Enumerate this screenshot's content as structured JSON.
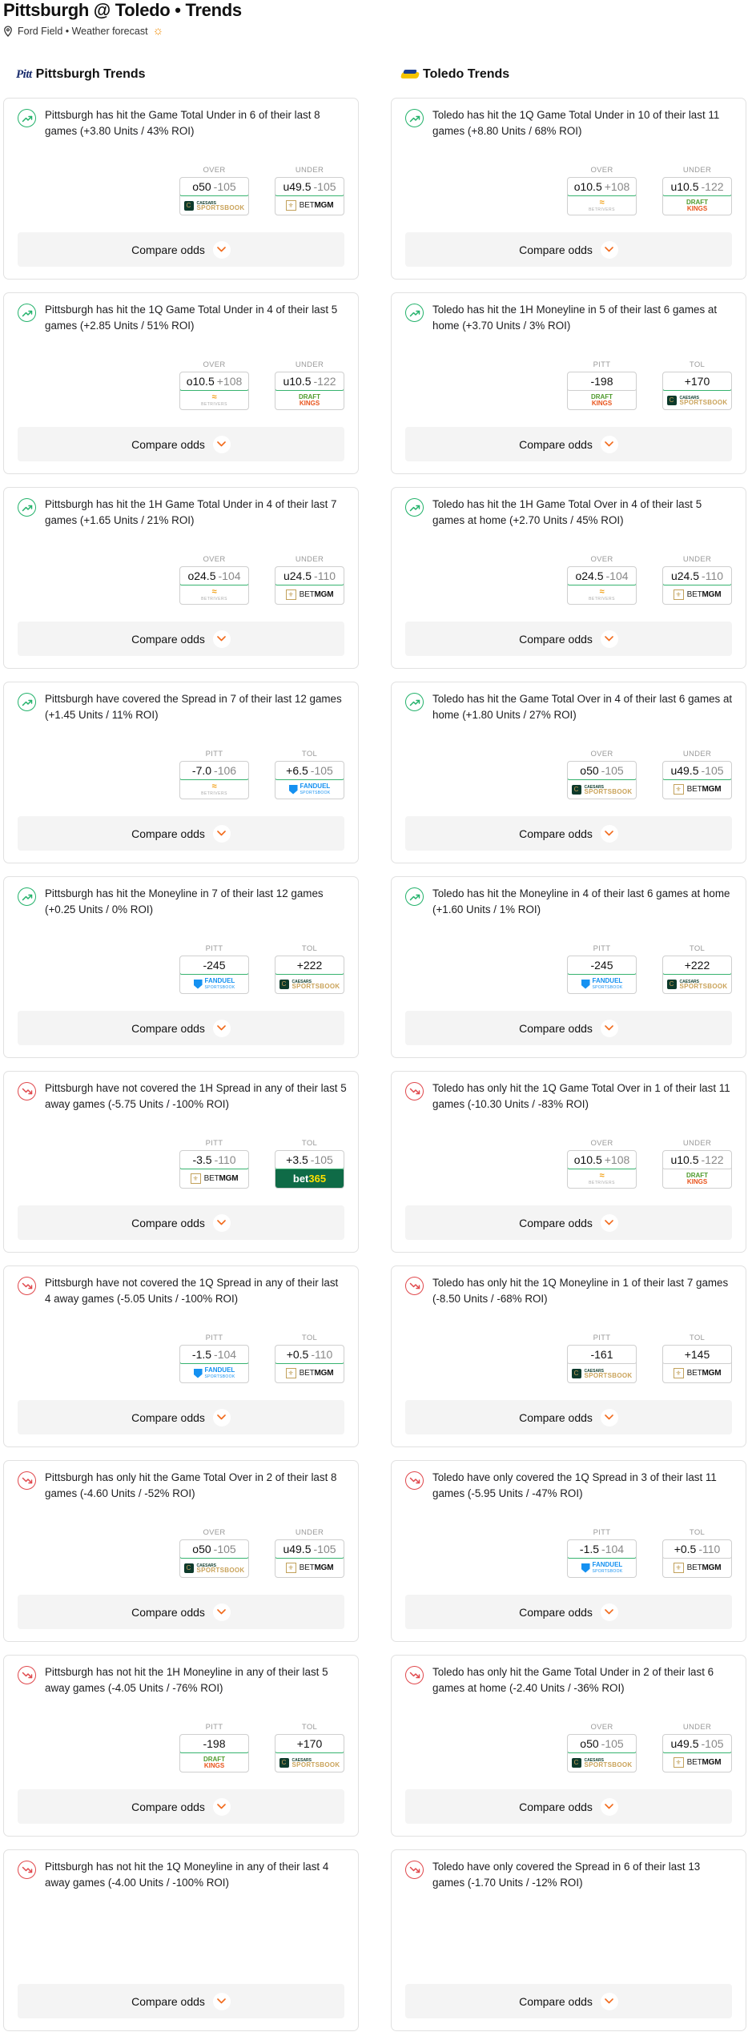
{
  "header": {
    "title": "Pittsburgh @ Toledo • Trends",
    "subtitle": "Ford Field • Weather forecast"
  },
  "columns": [
    {
      "id": "left",
      "heading": "Pittsburgh Trends",
      "logo_text": "Pitt",
      "cards": [
        {
          "trend": "up",
          "text": "Pittsburgh has hit the Game Total Under in 6 of their last 8 games (+3.80 Units / 43% ROI)",
          "bets": [
            {
              "label": "OVER",
              "line": "o50",
              "odds": "-105",
              "book": "caesars",
              "highlight": true
            },
            {
              "label": "UNDER",
              "line": "u49.5",
              "odds": "-105",
              "book": "betmgm",
              "highlight": true
            }
          ]
        },
        {
          "trend": "up",
          "text": "Pittsburgh has hit the 1Q Game Total Under in 4 of their last 5 games (+2.85 Units / 51% ROI)",
          "bets": [
            {
              "label": "OVER",
              "line": "o10.5",
              "odds": "+108",
              "book": "betrivers",
              "highlight": true
            },
            {
              "label": "UNDER",
              "line": "u10.5",
              "odds": "-122",
              "book": "draftkings",
              "highlight": true
            }
          ]
        },
        {
          "trend": "up",
          "text": "Pittsburgh has hit the 1H Game Total Under in 4 of their last 7 games (+1.65 Units / 21% ROI)",
          "bets": [
            {
              "label": "OVER",
              "line": "o24.5",
              "odds": "-104",
              "book": "betrivers",
              "highlight": true
            },
            {
              "label": "UNDER",
              "line": "u24.5",
              "odds": "-110",
              "book": "betmgm",
              "highlight": true
            }
          ]
        },
        {
          "trend": "up",
          "text": "Pittsburgh have covered the Spread in 7 of their last 12 games (+1.45 Units / 11% ROI)",
          "bets": [
            {
              "label": "PITT",
              "line": "-7.0",
              "odds": "-106",
              "book": "betrivers",
              "highlight": true
            },
            {
              "label": "TOL",
              "line": "+6.5",
              "odds": "-105",
              "book": "fanduel",
              "highlight": true
            }
          ]
        },
        {
          "trend": "up",
          "text": "Pittsburgh has hit the Moneyline in 7 of their last 12 games (+0.25 Units / 0% ROI)",
          "bets": [
            {
              "label": "PITT",
              "line": "",
              "odds": "-245",
              "book": "fanduel",
              "highlight": true
            },
            {
              "label": "TOL",
              "line": "",
              "odds": "+222",
              "book": "caesars",
              "highlight": true
            }
          ]
        },
        {
          "trend": "down",
          "text": "Pittsburgh have not covered the 1H Spread in any of their last 5 away games (-5.75 Units / -100% ROI)",
          "bets": [
            {
              "label": "PITT",
              "line": "-3.5",
              "odds": "-110",
              "book": "betmgm",
              "highlight": true
            },
            {
              "label": "TOL",
              "line": "+3.5",
              "odds": "-105",
              "book": "bet365",
              "highlight": true
            }
          ]
        },
        {
          "trend": "down",
          "text": "Pittsburgh have not covered the 1Q Spread in any of their last 4 away games (-5.05 Units / -100% ROI)",
          "bets": [
            {
              "label": "PITT",
              "line": "-1.5",
              "odds": "-104",
              "book": "fanduel",
              "highlight": true
            },
            {
              "label": "TOL",
              "line": "+0.5",
              "odds": "-110",
              "book": "betmgm",
              "highlight": true
            }
          ]
        },
        {
          "trend": "down",
          "text": "Pittsburgh has only hit the Game Total Over in 2 of their last 8 games (-4.60 Units / -52% ROI)",
          "bets": [
            {
              "label": "OVER",
              "line": "o50",
              "odds": "-105",
              "book": "caesars",
              "highlight": true
            },
            {
              "label": "UNDER",
              "line": "u49.5",
              "odds": "-105",
              "book": "betmgm",
              "highlight": true
            }
          ]
        },
        {
          "trend": "down",
          "text": "Pittsburgh has not hit the 1H Moneyline in any of their last 5 away games (-4.05 Units / -76% ROI)",
          "bets": [
            {
              "label": "PITT",
              "line": "",
              "odds": "-198",
              "book": "draftkings",
              "highlight": true
            },
            {
              "label": "TOL",
              "line": "",
              "odds": "+170",
              "book": "caesars",
              "highlight": true
            }
          ]
        },
        {
          "trend": "down",
          "text": "Pittsburgh has not hit the 1Q Moneyline in any of their last 4 away games (-4.00 Units / -100% ROI)",
          "bets": []
        }
      ]
    },
    {
      "id": "right",
      "heading": "Toledo Trends",
      "logo_text": "",
      "cards": [
        {
          "trend": "up",
          "text": "Toledo has hit the 1Q Game Total Under in 10 of their last 11 games (+8.80 Units / 68% ROI)",
          "bets": [
            {
              "label": "OVER",
              "line": "o10.5",
              "odds": "+108",
              "book": "betrivers",
              "highlight": true
            },
            {
              "label": "UNDER",
              "line": "u10.5",
              "odds": "-122",
              "book": "draftkings",
              "highlight": true
            }
          ]
        },
        {
          "trend": "up",
          "text": "Toledo has hit the 1H Moneyline in 5 of their last 6 games at home (+3.70 Units / 3% ROI)",
          "bets": [
            {
              "label": "PITT",
              "line": "",
              "odds": "-198",
              "book": "draftkings",
              "highlight": false
            },
            {
              "label": "TOL",
              "line": "",
              "odds": "+170",
              "book": "caesars",
              "highlight": true
            }
          ]
        },
        {
          "trend": "up",
          "text": "Toledo has hit the 1H Game Total Over in 4 of their last 5 games at home (+2.70 Units / 45% ROI)",
          "bets": [
            {
              "label": "OVER",
              "line": "o24.5",
              "odds": "-104",
              "book": "betrivers",
              "highlight": true
            },
            {
              "label": "UNDER",
              "line": "u24.5",
              "odds": "-110",
              "book": "betmgm",
              "highlight": true
            }
          ]
        },
        {
          "trend": "up",
          "text": "Toledo has hit the Game Total Over in 4 of their last 6 games at home (+1.80 Units / 27% ROI)",
          "bets": [
            {
              "label": "OVER",
              "line": "o50",
              "odds": "-105",
              "book": "caesars",
              "highlight": true
            },
            {
              "label": "UNDER",
              "line": "u49.5",
              "odds": "-105",
              "book": "betmgm",
              "highlight": true
            }
          ]
        },
        {
          "trend": "up",
          "text": "Toledo has hit the Moneyline in 4 of their last 6 games at home (+1.60 Units / 1% ROI)",
          "bets": [
            {
              "label": "PITT",
              "line": "",
              "odds": "-245",
              "book": "fanduel",
              "highlight": true
            },
            {
              "label": "TOL",
              "line": "",
              "odds": "+222",
              "book": "caesars",
              "highlight": true
            }
          ]
        },
        {
          "trend": "down",
          "text": "Toledo has only hit the 1Q Game Total Over in 1 of their last 11 games (-10.30 Units / -83% ROI)",
          "bets": [
            {
              "label": "OVER",
              "line": "o10.5",
              "odds": "+108",
              "book": "betrivers",
              "highlight": true
            },
            {
              "label": "UNDER",
              "line": "u10.5",
              "odds": "-122",
              "book": "draftkings",
              "highlight": false
            }
          ]
        },
        {
          "trend": "down",
          "text": "Toledo has only hit the 1Q Moneyline in 1 of their last 7 games (-8.50 Units / -68% ROI)",
          "bets": [
            {
              "label": "PITT",
              "line": "",
              "odds": "-161",
              "book": "caesars",
              "highlight": false
            },
            {
              "label": "TOL",
              "line": "",
              "odds": "+145",
              "book": "betmgm",
              "highlight": false
            }
          ]
        },
        {
          "trend": "down",
          "text": "Toledo have only covered the 1Q Spread in 3 of their last 11 games (-5.95 Units / -47% ROI)",
          "bets": [
            {
              "label": "PITT",
              "line": "-1.5",
              "odds": "-104",
              "book": "fanduel",
              "highlight": true
            },
            {
              "label": "TOL",
              "line": "+0.5",
              "odds": "-110",
              "book": "betmgm",
              "highlight": false
            }
          ]
        },
        {
          "trend": "down",
          "text": "Toledo has only hit the Game Total Under in 2 of their last 6 games at home (-2.40 Units / -36% ROI)",
          "bets": [
            {
              "label": "OVER",
              "line": "o50",
              "odds": "-105",
              "book": "caesars",
              "highlight": true
            },
            {
              "label": "UNDER",
              "line": "u49.5",
              "odds": "-105",
              "book": "betmgm",
              "highlight": true
            }
          ]
        },
        {
          "trend": "down",
          "text": "Toledo have only covered the Spread in 6 of their last 13 games (-1.70 Units / -12% ROI)",
          "bets": []
        }
      ]
    }
  ],
  "compare_label": "Compare odds",
  "books": {
    "caesars": {
      "line1": "CAESARS",
      "line2": "SPORTSBOOK",
      "mark": "C"
    },
    "betmgm": {
      "prefix": "BET",
      "name": "MGM",
      "mark": "⚜"
    },
    "betrivers": {
      "mark": "≈",
      "name": "BETRIVERS"
    },
    "draftkings": {
      "line1": "DRAFT",
      "line2": "KINGS"
    },
    "fanduel": {
      "line1": "FANDUEL",
      "line2": "SPORTSBOOK"
    },
    "bet365": {
      "prefix": "bet",
      "name": "365"
    }
  },
  "colors": {
    "up": "#23b26b",
    "down": "#e0484c",
    "accent": "#f26a1b",
    "highlight_border": "#37b36f"
  }
}
